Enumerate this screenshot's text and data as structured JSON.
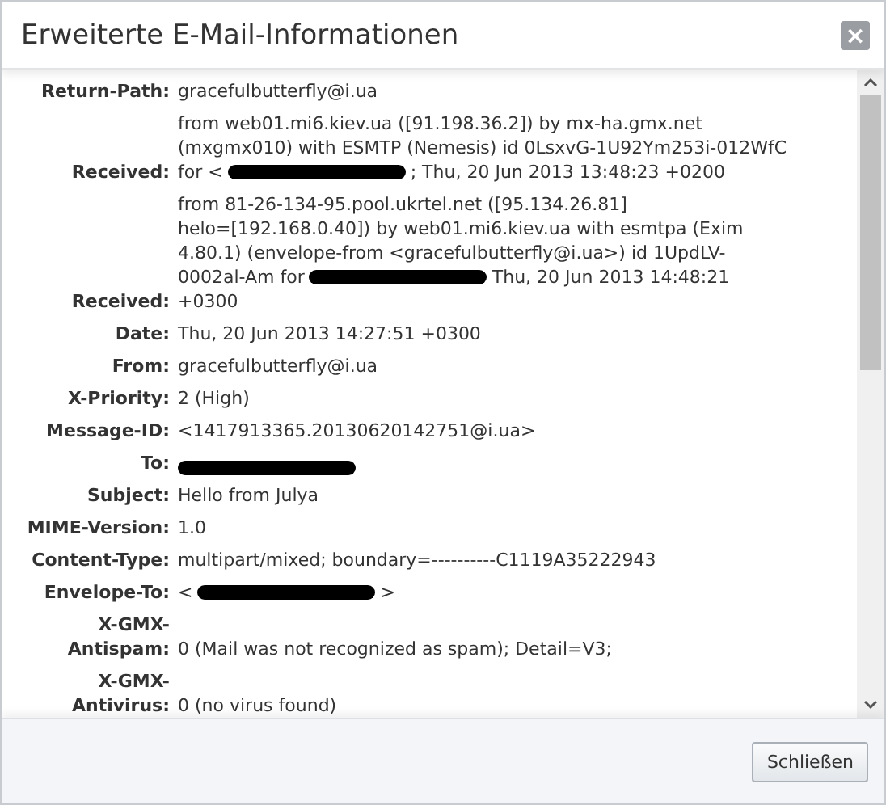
{
  "window": {
    "title": "Erweiterte E-Mail-Informationen",
    "close": "×"
  },
  "headers": [
    {
      "label": "Return-Path:",
      "lines": [
        [
          {
            "kind": "text",
            "text": "gracefulbutterfly@i.ua"
          }
        ]
      ]
    },
    {
      "label": "Received:",
      "lines": [
        [
          {
            "kind": "text",
            "text": "from web01.mi6.kiev.ua ([91.198.36.2]) by mx-ha.gmx.net"
          }
        ],
        [
          {
            "kind": "text",
            "text": "(mxgmx010) with ESMTP (Nemesis) id 0LsxvG-1U92Ym253i-012WfC"
          }
        ],
        [
          {
            "kind": "text",
            "text": "for <"
          },
          {
            "kind": "redacted"
          },
          {
            "kind": "text",
            "text": "; Thu, 20 Jun 2013 13:48:23 +0200"
          }
        ]
      ]
    },
    {
      "label": "Received:",
      "lines": [
        [
          {
            "kind": "text",
            "text": "from 81-26-134-95.pool.ukrtel.net ([95.134.26.81]"
          }
        ],
        [
          {
            "kind": "text",
            "text": "helo=[192.168.0.40]) by web01.mi6.kiev.ua with esmtpa (Exim"
          }
        ],
        [
          {
            "kind": "text",
            "text": "4.80.1) (envelope-from <gracefulbutterfly@i.ua>) id 1UpdLV-"
          }
        ],
        [
          {
            "kind": "text",
            "text": "0002al-Am for"
          },
          {
            "kind": "redacted"
          },
          {
            "kind": "text",
            "text": "Thu, 20 Jun 2013 14:48:21"
          }
        ],
        [
          {
            "kind": "text",
            "text": "+0300"
          }
        ]
      ]
    },
    {
      "label": "Date:",
      "lines": [
        [
          {
            "kind": "text",
            "text": "Thu, 20 Jun 2013 14:27:51 +0300"
          }
        ]
      ]
    },
    {
      "label": "From:",
      "lines": [
        [
          {
            "kind": "text",
            "text": "gracefulbutterfly@i.ua"
          }
        ]
      ]
    },
    {
      "label": "X-Priority:",
      "lines": [
        [
          {
            "kind": "text",
            "text": "2 (High)"
          }
        ]
      ]
    },
    {
      "label": "Message-ID:",
      "lines": [
        [
          {
            "kind": "text",
            "text": "<1417913365.20130620142751@i.ua>"
          }
        ]
      ]
    },
    {
      "label": "To:",
      "lines": [
        [
          {
            "kind": "redacted"
          }
        ]
      ]
    },
    {
      "label": "Subject:",
      "lines": [
        [
          {
            "kind": "text",
            "text": "Hello from Julya"
          }
        ]
      ]
    },
    {
      "label": "MIME-Version:",
      "lines": [
        [
          {
            "kind": "text",
            "text": "1.0"
          }
        ]
      ]
    },
    {
      "label": "Content-Type:",
      "lines": [
        [
          {
            "kind": "text",
            "text": "multipart/mixed; boundary=----------C1119A35222943"
          }
        ]
      ]
    },
    {
      "label": "Envelope-To:",
      "lines": [
        [
          {
            "kind": "text",
            "text": "<"
          },
          {
            "kind": "redacted"
          },
          {
            "kind": "text",
            "text": ">"
          }
        ]
      ]
    },
    {
      "label": "X-GMX-Antispam:",
      "lines": [
        [
          {
            "kind": "text",
            "text": "0 (Mail was not recognized as spam); Detail=V3;"
          }
        ]
      ]
    },
    {
      "label": "X-GMX-Antivirus:",
      "lines": [
        [
          {
            "kind": "text",
            "text": "0 (no virus found)"
          }
        ]
      ]
    }
  ],
  "buttons": [
    "Schließen"
  ]
}
